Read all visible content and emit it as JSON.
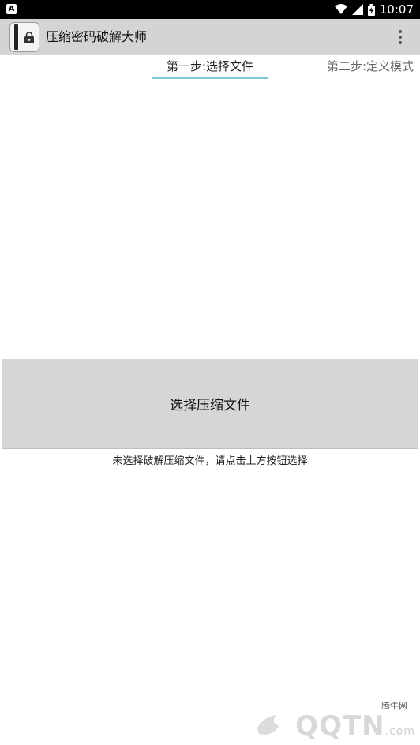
{
  "status_bar": {
    "left_icon": "A",
    "time": "10:07",
    "icons": [
      "wifi-icon",
      "signal-icon",
      "battery-icon"
    ]
  },
  "app_bar": {
    "title": "压缩密码破解大师",
    "icon": "archive-lock-icon",
    "menu_icon": "overflow-menu-icon"
  },
  "tabs": [
    {
      "label": "第一步:选择文件",
      "selected": true
    },
    {
      "label": "第二步:定义模式",
      "selected": false
    }
  ],
  "main": {
    "select_button_label": "选择压缩文件",
    "hint": "未选择破解压缩文件，请点击上方按钮选择"
  },
  "watermark": {
    "site_name": "腾牛网",
    "brand": "QQTN",
    "suffix": ".com"
  },
  "colors": {
    "status_bar": "#000000",
    "app_bar": "#d4d4d4",
    "tab_indicator": "#80c8dd",
    "button_bg": "#d6d6d6"
  }
}
